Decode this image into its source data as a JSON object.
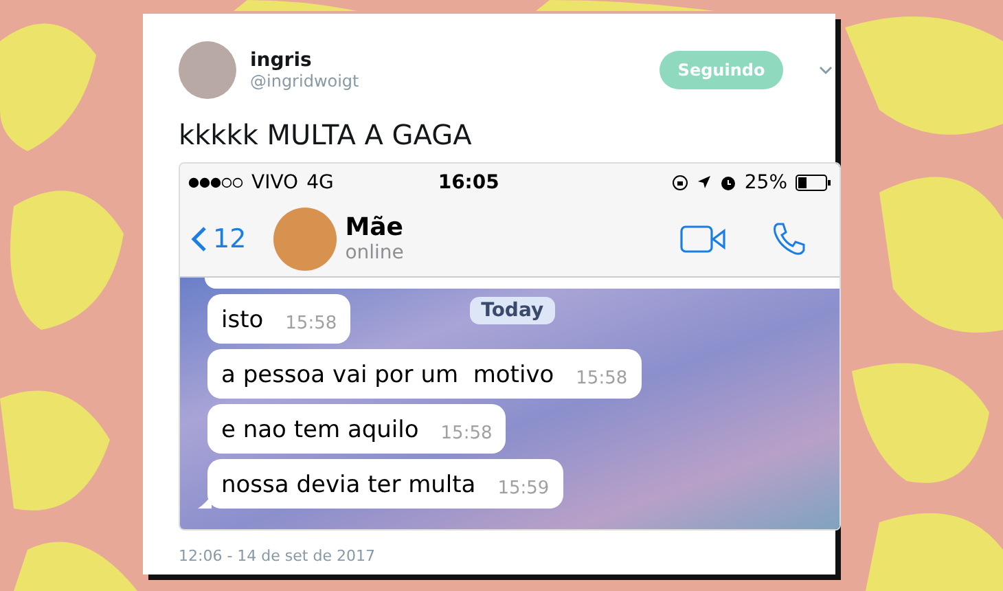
{
  "tweet": {
    "name": "ingris",
    "handle": "@ingridwoigt",
    "follow_button": "Seguindo",
    "text": "kkkkk MULTA A GAGA",
    "timestamp": "12:06 - 14 de set de 2017"
  },
  "phone": {
    "status_bar": {
      "carrier": "VIVO",
      "network": "4G",
      "time": "16:05",
      "battery": "25%"
    },
    "chat_header": {
      "back_count": "12",
      "contact": "Mãe",
      "status": "online"
    },
    "day_label": "Today",
    "messages": [
      {
        "text": "isto",
        "time": "15:58",
        "tail": false
      },
      {
        "text": "a pessoa vai por um  motivo",
        "time": "15:58",
        "tail": false
      },
      {
        "text": "e nao tem aquilo",
        "time": "15:58",
        "tail": false
      },
      {
        "text": "nossa devia ter multa",
        "time": "15:59",
        "tail": true
      }
    ]
  }
}
